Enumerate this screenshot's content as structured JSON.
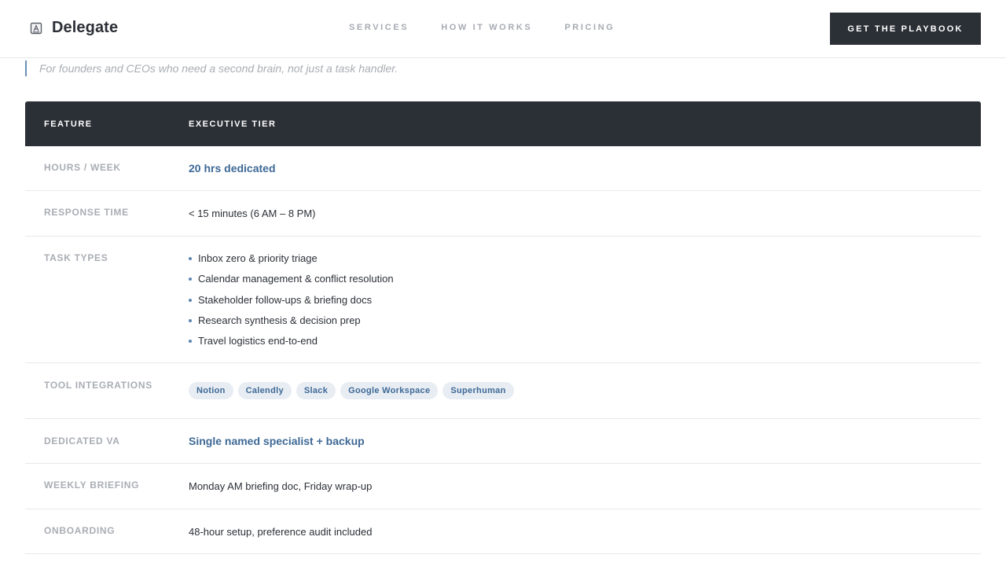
{
  "header": {
    "brand_icon": "document-icon",
    "brand_name": "Delegate",
    "nav": [
      {
        "label": "SERVICES"
      },
      {
        "label": "HOW IT WORKS"
      },
      {
        "label": "PRICING"
      }
    ],
    "cta_label": "GET THE PLAYBOOK"
  },
  "tagline": "For founders and CEOs who need a second brain, not just a task handler.",
  "table": {
    "headers": {
      "feature": "FEATURE",
      "tier": "EXECUTIVE TIER"
    },
    "hours": {
      "label": "HOURS / WEEK",
      "value": "20 hrs dedicated"
    },
    "response": {
      "label": "RESPONSE TIME",
      "value": "< 15 minutes (6 AM – 8 PM)"
    },
    "tasks": {
      "label": "TASK TYPES",
      "items": [
        "Inbox zero & priority triage",
        "Calendar management & conflict resolution",
        "Stakeholder follow-ups & briefing docs",
        "Research synthesis & decision prep",
        "Travel logistics end-to-end"
      ]
    },
    "tools": {
      "label": "TOOL INTEGRATIONS",
      "chips": [
        "Notion",
        "Calendly",
        "Slack",
        "Google Workspace",
        "Superhuman"
      ]
    },
    "va": {
      "label": "DEDICATED VA",
      "value": "Single named specialist + backup"
    },
    "briefing": {
      "label": "WEEKLY BRIEFING",
      "value": "Monday AM briefing doc, Friday wrap-up"
    },
    "onboarding": {
      "label": "ONBOARDING",
      "value": "48-hour setup, preference audit included"
    }
  },
  "colors": {
    "dark": "#2b2f36",
    "accent": "#3e6996",
    "muted": "#a9adb3",
    "chip_bg": "#e8edf3"
  }
}
